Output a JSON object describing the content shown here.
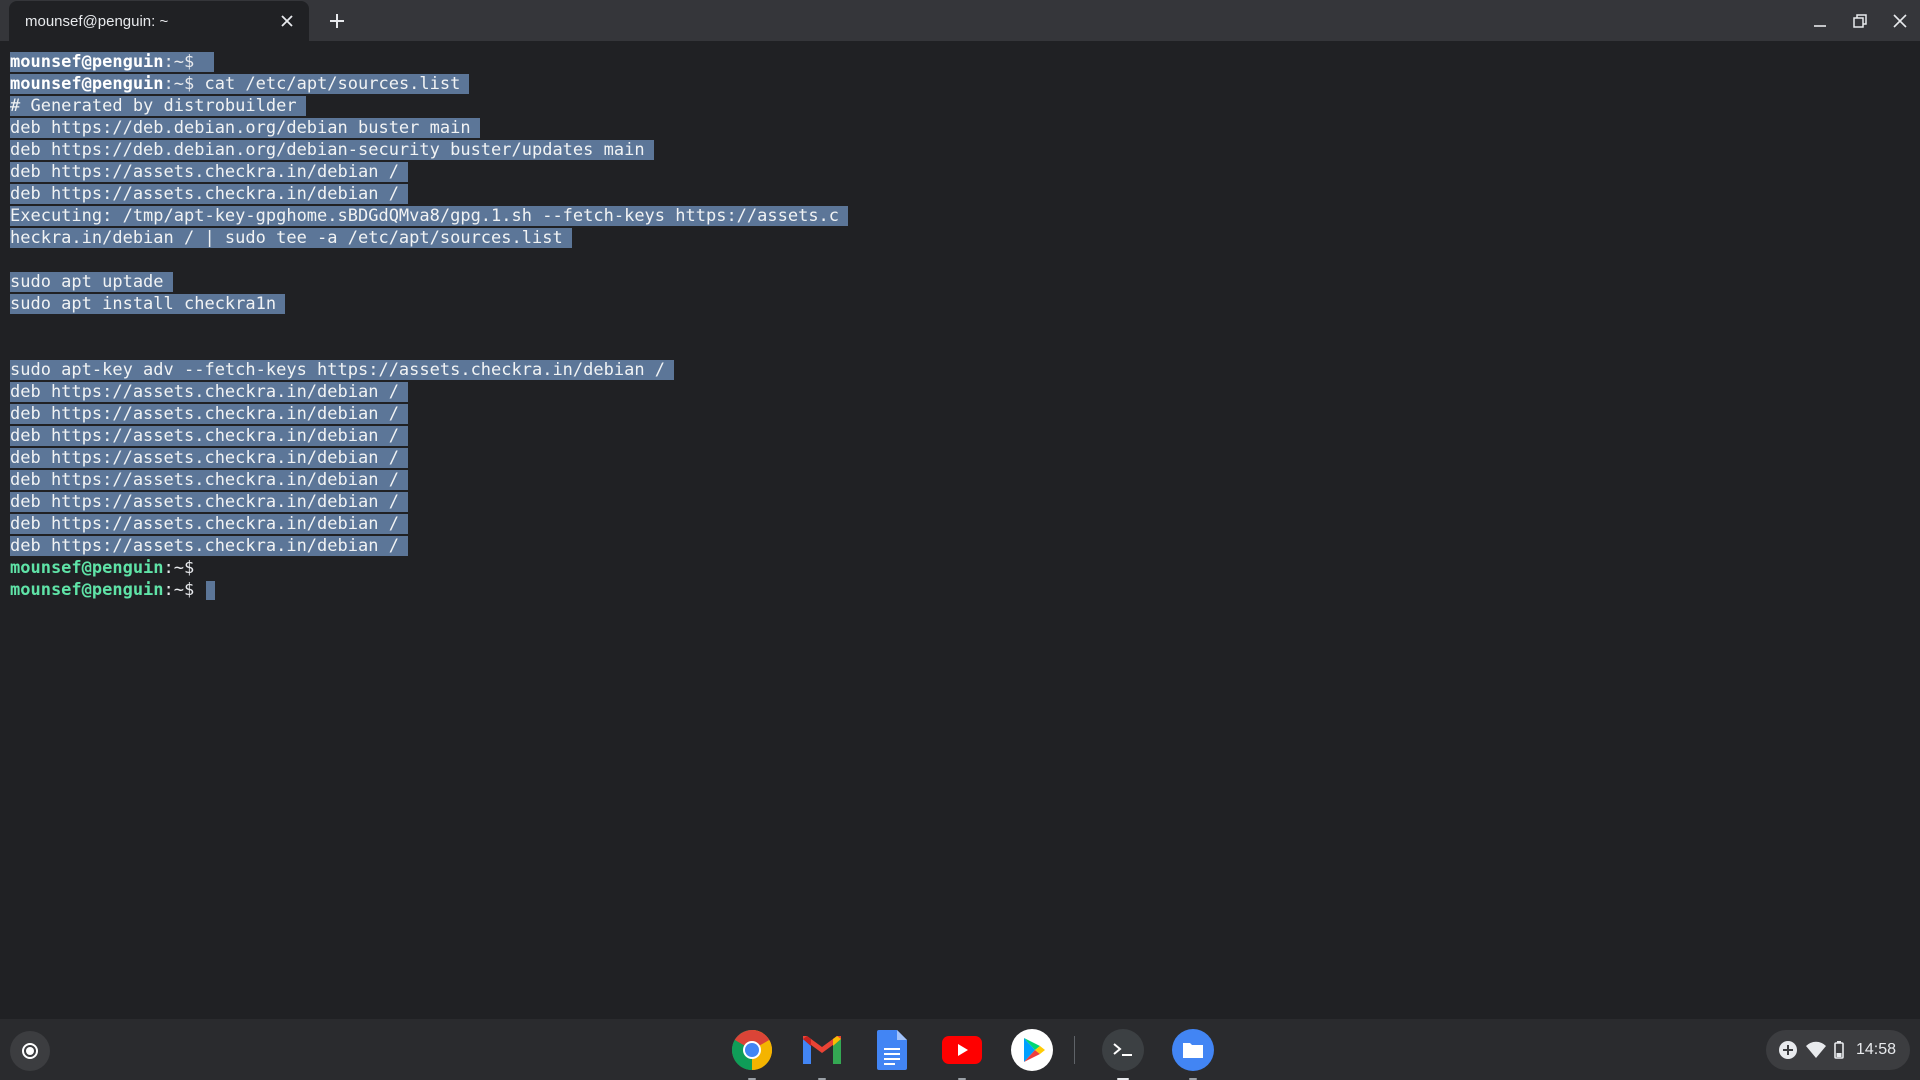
{
  "window": {
    "tab_title": "mounsef@penguin: ~",
    "new_tab_label": "+"
  },
  "terminal": {
    "prompt_user": "mounsef@penguin",
    "prompt_path": ":~$",
    "lines": [
      {
        "type": "prompt",
        "cmd": " ",
        "selected": true
      },
      {
        "type": "prompt",
        "cmd": " cat /etc/apt/sources.list",
        "selected": true
      },
      {
        "type": "text",
        "text": "# Generated by distrobuilder",
        "selected": true
      },
      {
        "type": "text",
        "text": "deb https://deb.debian.org/debian buster main",
        "selected": true
      },
      {
        "type": "text",
        "text": "deb https://deb.debian.org/debian-security buster/updates main",
        "selected": true
      },
      {
        "type": "text",
        "text": "deb https://assets.checkra.in/debian /",
        "selected": true
      },
      {
        "type": "text",
        "text": "deb https://assets.checkra.in/debian /",
        "selected": true
      },
      {
        "type": "text",
        "text": "Executing: /tmp/apt-key-gpghome.sBDGdQMva8/gpg.1.sh --fetch-keys https://assets.c",
        "selected": true
      },
      {
        "type": "text",
        "text": "heckra.in/debian / | sudo tee -a /etc/apt/sources.list",
        "selected": true
      },
      {
        "type": "text",
        "text": "",
        "selected": false
      },
      {
        "type": "text",
        "text": "sudo apt uptade",
        "selected": true
      },
      {
        "type": "text",
        "text": "sudo apt install checkra1n",
        "selected": true
      },
      {
        "type": "text",
        "text": "",
        "selected": false
      },
      {
        "type": "text",
        "text": "",
        "selected": false
      },
      {
        "type": "text",
        "text": "sudo apt-key adv --fetch-keys https://assets.checkra.in/debian /",
        "selected": true
      },
      {
        "type": "text",
        "text": "deb https://assets.checkra.in/debian /",
        "selected": true
      },
      {
        "type": "text",
        "text": "deb https://assets.checkra.in/debian /",
        "selected": true
      },
      {
        "type": "text",
        "text": "deb https://assets.checkra.in/debian /",
        "selected": true
      },
      {
        "type": "text",
        "text": "deb https://assets.checkra.in/debian /",
        "selected": true
      },
      {
        "type": "text",
        "text": "deb https://assets.checkra.in/debian /",
        "selected": true
      },
      {
        "type": "text",
        "text": "deb https://assets.checkra.in/debian /",
        "selected": true
      },
      {
        "type": "text",
        "text": "deb https://assets.checkra.in/debian /",
        "selected": true
      },
      {
        "type": "text",
        "text": "deb https://assets.checkra.in/debian /",
        "selected": true
      },
      {
        "type": "prompt",
        "cmd": "",
        "selected": false
      },
      {
        "type": "prompt",
        "cmd": " ",
        "selected": false,
        "cursor": true
      }
    ]
  },
  "shelf": {
    "apps": [
      {
        "name": "chrome",
        "running": true,
        "active": false
      },
      {
        "name": "gmail",
        "running": true,
        "active": false
      },
      {
        "name": "docs",
        "running": false,
        "active": false
      },
      {
        "name": "youtube",
        "running": true,
        "active": false
      },
      {
        "name": "play-store",
        "running": false,
        "active": false
      },
      {
        "name": "terminal",
        "running": true,
        "active": true
      },
      {
        "name": "files",
        "running": true,
        "active": false
      }
    ],
    "time": "14:58"
  },
  "colors": {
    "background": "#202124",
    "selection": "#5c7698",
    "prompt_user": "#5fe3a7",
    "titlebar": "#35363a"
  }
}
